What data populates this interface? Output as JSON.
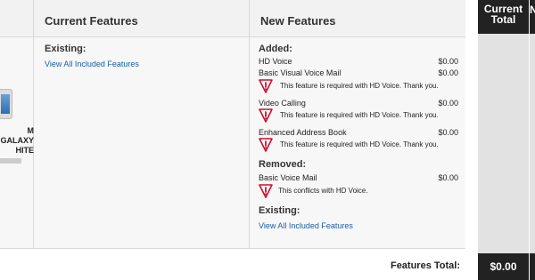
{
  "headers": {
    "current": "Current Features",
    "new": "New Features",
    "total": "Current Total",
    "edge": "N"
  },
  "device": {
    "name": "M\nGALAXY\nHITE"
  },
  "current": {
    "existing_label": "Existing:",
    "view_all_link": "View All Included Features"
  },
  "new_features": {
    "added_label": "Added:",
    "added": [
      {
        "name": "HD Voice",
        "price": "$0.00"
      },
      {
        "name": "Basic Visual Voice Mail",
        "price": "$0.00",
        "warning": "This feature is required with HD Voice. Thank you."
      },
      {
        "name": "Video Calling",
        "price": "$0.00",
        "warning": "This feature is required with HD Voice. Thank you."
      },
      {
        "name": "Enhanced Address Book",
        "price": "$0.00",
        "warning": "This feature is required with HD Voice. Thank you."
      }
    ],
    "removed_label": "Removed:",
    "removed": [
      {
        "name": "Basic Voice Mail",
        "price": "$0.00",
        "warning": "This conflicts with HD Voice."
      }
    ],
    "existing_label": "Existing:",
    "view_all_link": "View All Included Features"
  },
  "footer": {
    "label": "Features Total:",
    "total": "$0.00"
  },
  "colors": {
    "link": "#1a5ea8",
    "warning_icon": "#c8102e",
    "dark_header": "#222222"
  }
}
